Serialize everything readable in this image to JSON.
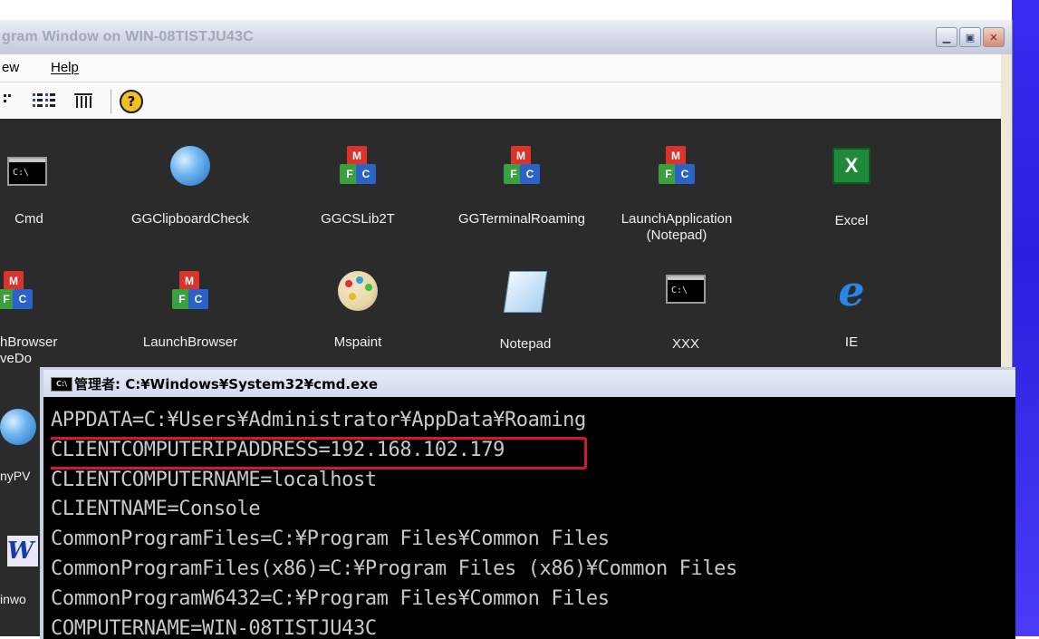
{
  "window": {
    "title": "gram Window on WIN-08TISTJU43C",
    "controls": [
      "minimize",
      "restore",
      "close"
    ]
  },
  "menu": [
    "ew",
    "Help"
  ],
  "toolbar": {
    "help_glyph": "?"
  },
  "icons_row1": [
    {
      "label": "Cmd",
      "icon": "cmd-icon"
    },
    {
      "label": "GGClipboardCheck",
      "icon": "globe-icon"
    },
    {
      "label": "GGCSLib2T",
      "icon": "blocks-icon"
    },
    {
      "label": "GGTerminalRoaming",
      "icon": "blocks-icon"
    },
    {
      "label": "LaunchApplication",
      "label2": "(Notepad)",
      "icon": "blocks-icon"
    },
    {
      "label": "Excel",
      "icon": "excel-icon"
    }
  ],
  "icons_row2": [
    {
      "label": "hBrowser",
      "label2": "veDo",
      "icon": "blocks-icon"
    },
    {
      "label": "LaunchBrowser",
      "icon": "blocks-icon"
    },
    {
      "label": "Mspaint",
      "icon": "paint-icon"
    },
    {
      "label": "Notepad",
      "icon": "notepad-icon"
    },
    {
      "label": "XXX",
      "icon": "cmd-icon"
    },
    {
      "label": "IE",
      "icon": "ie-icon"
    }
  ],
  "left_fragments": [
    "nyPV",
    "inwo"
  ],
  "cmd": {
    "title": "管理者: C:¥Windows¥System32¥cmd.exe",
    "icon_text": "C:\\",
    "lines": [
      "APPDATA=C:¥Users¥Administrator¥AppData¥Roaming",
      "CLIENTCOMPUTERIPADDRESS=192.168.102.179",
      "CLIENTCOMPUTERNAME=localhost",
      "CLIENTNAME=Console",
      "CommonProgramFiles=C:¥Program Files¥Common Files",
      "CommonProgramFiles(x86)=C:¥Program Files (x86)¥Common Files",
      "CommonProgramW6432=C:¥Program Files¥Common Files",
      "COMPUTERNAME=WIN-08TISTJU43C"
    ],
    "highlight_color": "#d01c2a"
  }
}
